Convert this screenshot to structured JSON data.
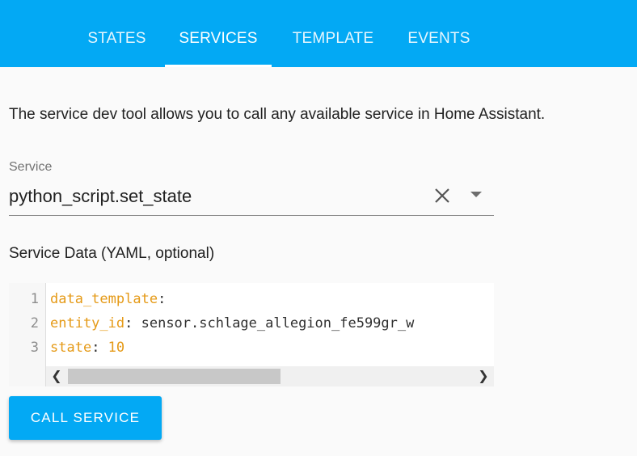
{
  "tabs": [
    {
      "label": "STATES",
      "active": false
    },
    {
      "label": "SERVICES",
      "active": true
    },
    {
      "label": "TEMPLATE",
      "active": false
    },
    {
      "label": "EVENTS",
      "active": false
    }
  ],
  "description": "The service dev tool allows you to call any available service in Home Assistant.",
  "service": {
    "label": "Service",
    "value": "python_script.set_state",
    "clear_icon": "close-icon",
    "dropdown_icon": "arrow-drop-down-icon"
  },
  "service_data": {
    "label": "Service Data (YAML, optional)",
    "lines": [
      {
        "number": "1",
        "key": "data_template",
        "sep": ":",
        "value": ""
      },
      {
        "number": "2",
        "key": "entity_id",
        "sep": ":",
        "value": " sensor.schlage_allegion_fe599gr_w"
      },
      {
        "number": "3",
        "key": "state",
        "sep": ":",
        "value": " 10"
      }
    ],
    "scroll_left_icon": "chevron-left-icon",
    "scroll_right_icon": "chevron-right-icon",
    "scroll_position": 0
  },
  "call_button": "CALL SERVICE",
  "colors": {
    "accent": "#03a9f4",
    "yaml_key": "#e59a17",
    "yaml_number": "#e59a17"
  }
}
